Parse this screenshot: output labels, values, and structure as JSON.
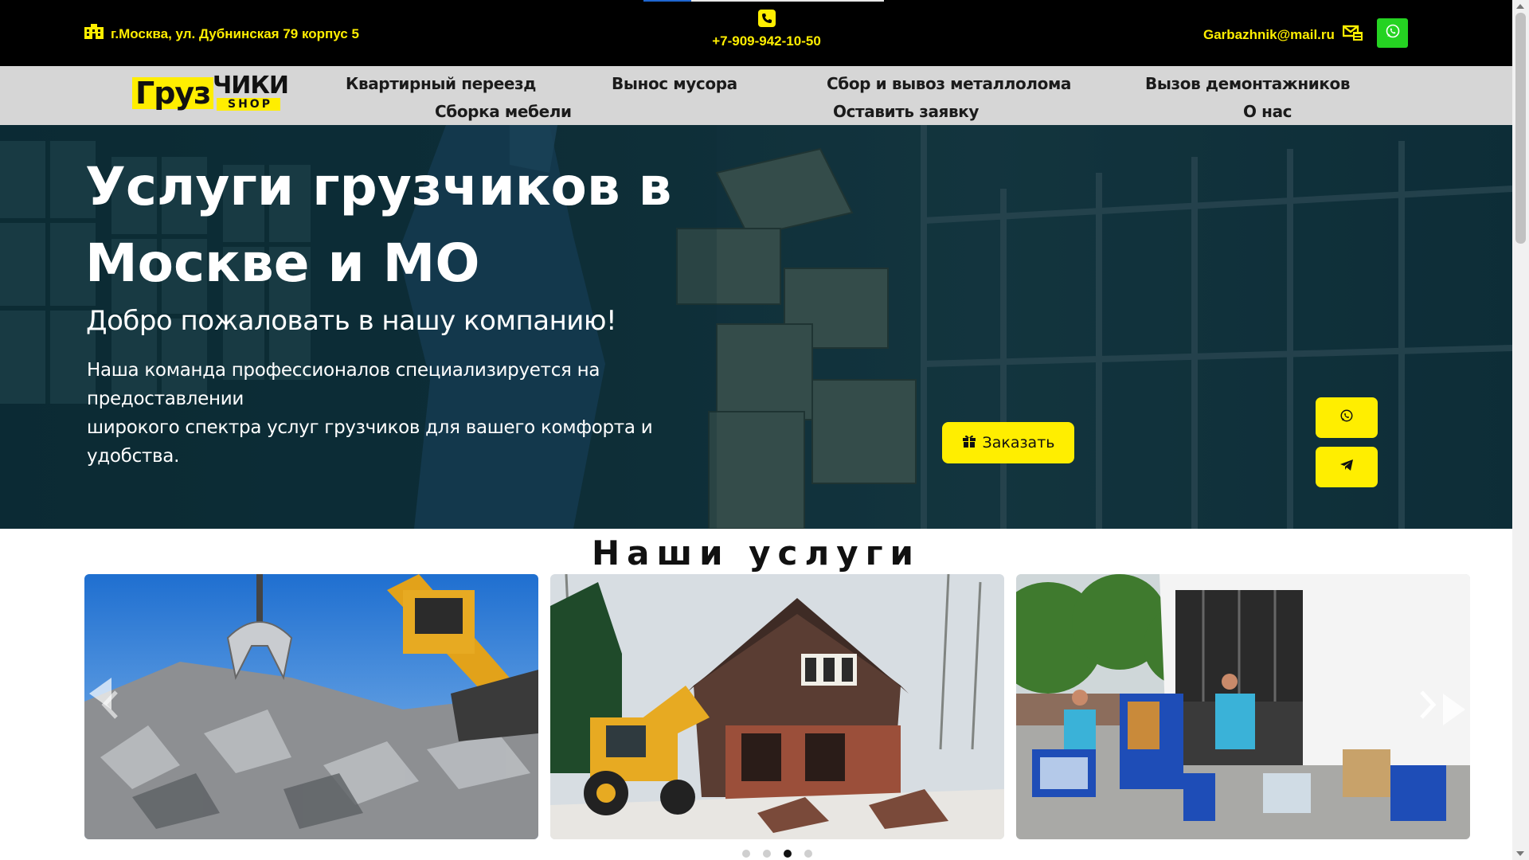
{
  "colors": {
    "accent": "#ffee00",
    "whatsapp": "#25d322",
    "topbar": "#000000",
    "nav": "#d6d6d6"
  },
  "topbar": {
    "address": "г.Москва, ул. Дубнинская 79 корпус 5",
    "address_icon": "building-icon",
    "phone": "+7-909-942-10-50",
    "phone_icon": "phone-icon",
    "email": "Garbazhnik@mail.ru",
    "email_icon": "mail-icon",
    "whatsapp_icon": "whatsapp-icon"
  },
  "logo": {
    "part1": "Груз",
    "part2": "ЧИКИ",
    "part3": "SHOP"
  },
  "nav": {
    "items": [
      "Квартирный переезд",
      "Вынос мусора",
      "Сбор и вывоз металлолома",
      "Вызов демонтажников",
      "Сборка мебели",
      "Оставить заявку",
      "О нас"
    ]
  },
  "hero": {
    "title_line1": "Услуги грузчиков в",
    "title_line2": "Москве и МО",
    "subtitle": "Добро пожаловать в нашу компанию!",
    "text_line1": "Наша команда профессионалов специализируется на предоставлении",
    "text_line2": "широкого спектра услуг грузчиков для вашего комфорта и удобства.",
    "order_button": "Заказать",
    "order_icon": "gift-icon",
    "float_buttons": [
      "whatsapp-icon",
      "telegram-icon"
    ]
  },
  "services": {
    "title": "Наши услуги",
    "cards": [
      "scrap-metal-photo",
      "house-demolition-photo",
      "moving-truck-photo"
    ],
    "carousel": {
      "total": 4,
      "active": 3
    }
  }
}
